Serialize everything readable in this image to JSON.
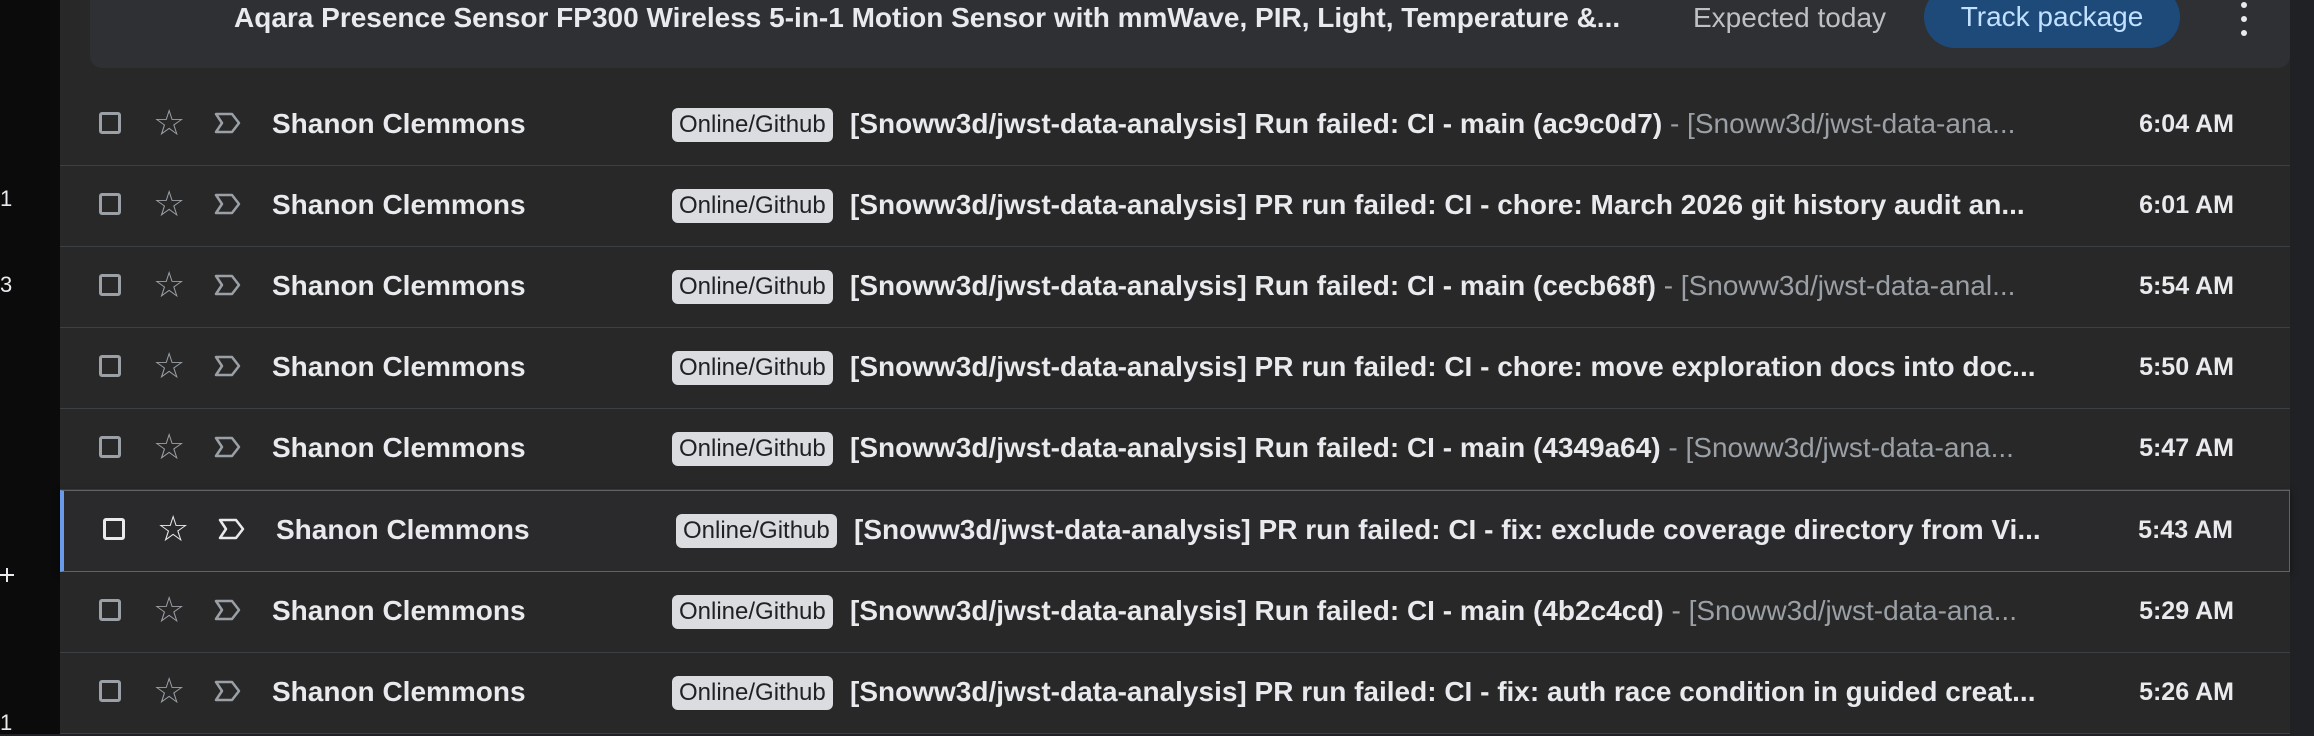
{
  "rail": {
    "numbers": [
      "1",
      "3",
      "1"
    ]
  },
  "package": {
    "title": "Aqara Presence Sensor FP300 Wireless 5-in-1 Motion Sensor with mmWave, PIR, Light, Temperature &...",
    "status": "Expected today",
    "track_label": "Track package",
    "more_icon": "more-vert-icon"
  },
  "emails": [
    {
      "sender": "Shanon Clemmons",
      "label": "Online/Github",
      "subject": "[Snoww3d/jwst-data-analysis] Run failed: CI - main (ac9c0d7)",
      "snippet": " - [Snoww3d/jwst-data-ana...",
      "time": "6:04 AM"
    },
    {
      "sender": "Shanon Clemmons",
      "label": "Online/Github",
      "subject": "[Snoww3d/jwst-data-analysis] PR run failed: CI - chore: March 2026 git history audit an...",
      "snippet": "",
      "time": "6:01 AM"
    },
    {
      "sender": "Shanon Clemmons",
      "label": "Online/Github",
      "subject": "[Snoww3d/jwst-data-analysis] Run failed: CI - main (cecb68f)",
      "snippet": " - [Snoww3d/jwst-data-anal...",
      "time": "5:54 AM"
    },
    {
      "sender": "Shanon Clemmons",
      "label": "Online/Github",
      "subject": "[Snoww3d/jwst-data-analysis] PR run failed: CI - chore: move exploration docs into doc...",
      "snippet": "",
      "time": "5:50 AM"
    },
    {
      "sender": "Shanon Clemmons",
      "label": "Online/Github",
      "subject": "[Snoww3d/jwst-data-analysis] Run failed: CI - main (4349a64)",
      "snippet": " - [Snoww3d/jwst-data-ana...",
      "time": "5:47 AM"
    },
    {
      "sender": "Shanon Clemmons",
      "label": "Online/Github",
      "subject": "[Snoww3d/jwst-data-analysis] PR run failed: CI - fix: exclude coverage directory from Vi...",
      "snippet": "",
      "time": "5:43 AM",
      "active": true
    },
    {
      "sender": "Shanon Clemmons",
      "label": "Online/Github",
      "subject": "[Snoww3d/jwst-data-analysis] Run failed: CI - main (4b2c4cd)",
      "snippet": " - [Snoww3d/jwst-data-ana...",
      "time": "5:29 AM"
    },
    {
      "sender": "Shanon Clemmons",
      "label": "Online/Github",
      "subject": "[Snoww3d/jwst-data-analysis] PR run failed: CI - fix: auth race condition in guided creat...",
      "snippet": "",
      "time": "5:26 AM"
    }
  ],
  "icons": {
    "checkbox": "checkbox-icon",
    "star": "star-icon",
    "important": "important-marker-icon"
  },
  "colors": {
    "accent": "#6a9bea",
    "track_button": "#1e4a7a",
    "label_bg": "#dadce0"
  }
}
